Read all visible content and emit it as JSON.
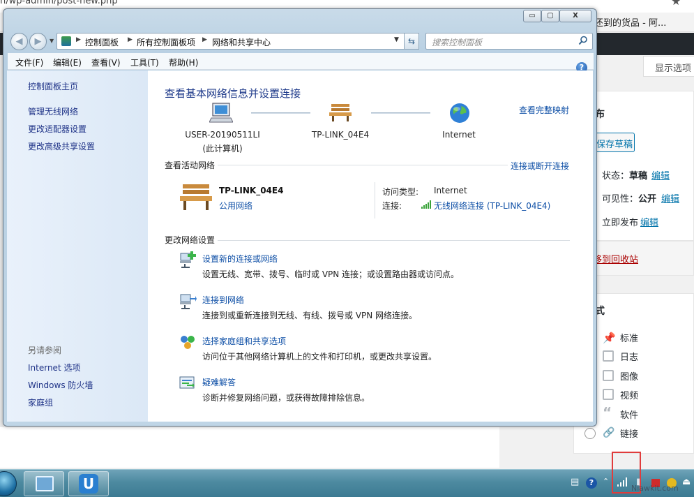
{
  "browser": {
    "url_fragment": "n/wp-admin/post-new.php",
    "tab_title": "还到的货品 - 阿..."
  },
  "wordpress": {
    "screen_options": "显示选项",
    "publish_heading_fragment": "布",
    "save_draft": "保存草稿",
    "status_label": "状态：",
    "status_value": "草稿",
    "visibility_label": "可见性：",
    "visibility_value": "公开",
    "publish_now": "立即发布",
    "edit_link": "编辑",
    "trash_link": "移到回收站",
    "format_heading_fragment": "式",
    "formats": [
      "标准",
      "日志",
      "图像",
      "视频",
      "软件",
      "链接"
    ]
  },
  "window": {
    "min_glyph": "▭",
    "max_glyph": "▢",
    "close_glyph": "X",
    "breadcrumbs": [
      "控制面板",
      "所有控制面板项",
      "网络和共享中心"
    ],
    "search_placeholder": "搜索控制面板",
    "menu": [
      "文件(F)",
      "编辑(E)",
      "查看(V)",
      "工具(T)",
      "帮助(H)"
    ],
    "help_glyph": "?"
  },
  "sidebar": {
    "home": "控制面板主页",
    "links": [
      "管理无线网络",
      "更改适配器设置",
      "更改高级共享设置"
    ],
    "see_also_heading": "另请参阅",
    "see_also": [
      "Internet 选项",
      "Windows 防火墙",
      "家庭组"
    ]
  },
  "main": {
    "title": "查看基本网络信息并设置连接",
    "view_full_map": "查看完整映射",
    "devices": [
      {
        "name": "USER-20190511LI",
        "sub": "(此计算机)"
      },
      {
        "name": "TP-LINK_04E4",
        "sub": ""
      },
      {
        "name": "Internet",
        "sub": ""
      }
    ],
    "active_section": "查看活动网络",
    "connect_disconnect": "连接或断开连接",
    "network": {
      "name": "TP-LINK_04E4",
      "type": "公用网络",
      "access_type_label": "访问类型:",
      "access_type_value": "Internet",
      "connection_label": "连接:",
      "connection_value": "无线网络连接 (TP-LINK_04E4)"
    },
    "change_section": "更改网络设置",
    "tasks": [
      {
        "link": "设置新的连接或网络",
        "desc": "设置无线、宽带、拨号、临时或 VPN 连接；或设置路由器或访问点。"
      },
      {
        "link": "连接到网络",
        "desc": "连接到或重新连接到无线、有线、拨号或 VPN 网络连接。"
      },
      {
        "link": "选择家庭组和共享选项",
        "desc": "访问位于其他网络计算机上的文件和打印机，或更改共享设置。"
      },
      {
        "link": "疑难解答",
        "desc": "诊断并修复网络问题，或获得故障排除信息。"
      }
    ]
  },
  "taskbar": {
    "app2_glyph": "U",
    "watermark": "Niawkit.com",
    "colors": {
      "highlight": "#e03c3c"
    }
  },
  "colors": {
    "link": "#0e4fa6",
    "title": "#1e3a8a",
    "wp_link": "#0073aa"
  }
}
